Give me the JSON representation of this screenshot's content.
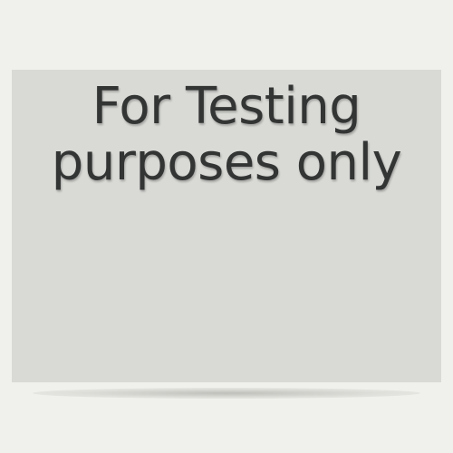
{
  "card": {
    "line1": "For Testing",
    "line2": "purposes only"
  },
  "colors": {
    "background": "#f0f0ec",
    "panel": "#d9dad6",
    "text": "#333534"
  }
}
